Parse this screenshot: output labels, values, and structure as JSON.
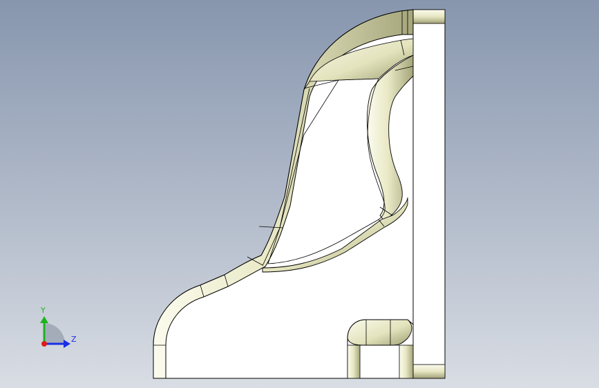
{
  "viewport": {
    "background_top": "#8796ae",
    "background_bottom": "#d9dde4"
  },
  "model": {
    "face_color": "#ffffff",
    "edge_color": "#000000",
    "fillet_shade_light": "#fbfbee",
    "fillet_shade_dark": "#a6a67c"
  },
  "triad": {
    "y_label": "Y",
    "z_label": "Z",
    "y_color": "#1db31d",
    "z_color": "#1a2fe6",
    "x_color": "#e01a1a"
  }
}
